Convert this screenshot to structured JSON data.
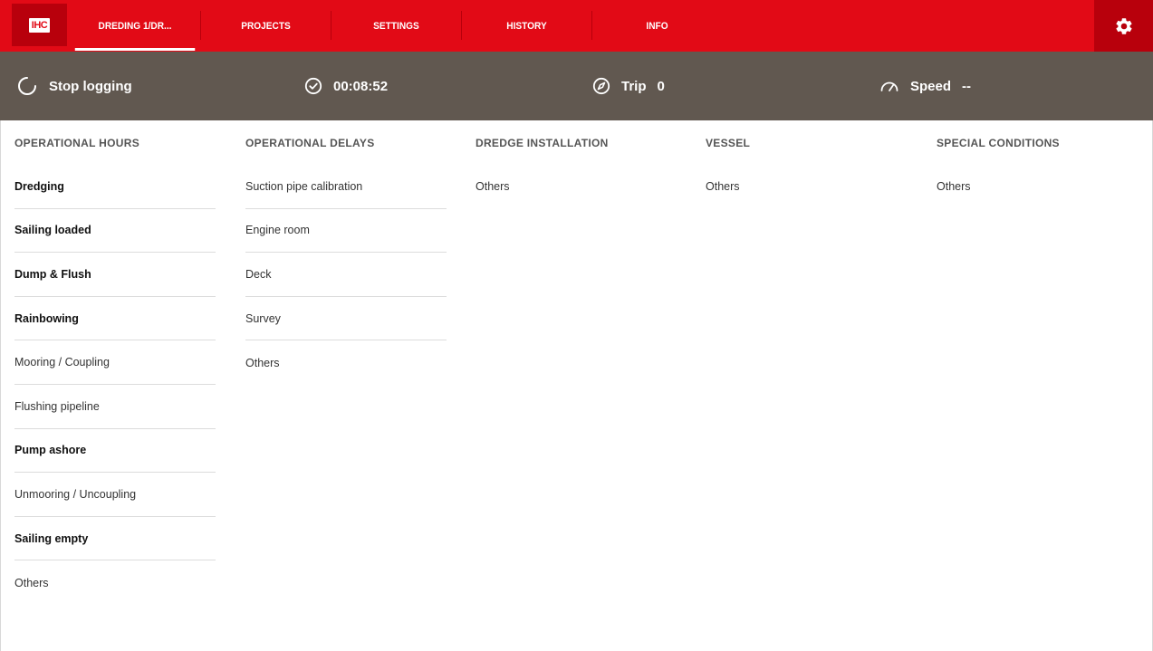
{
  "nav": {
    "logo": "IHC",
    "tabs": [
      {
        "label": "DREDING 1/DR..."
      },
      {
        "label": "PROJECTS"
      },
      {
        "label": "SETTINGS"
      },
      {
        "label": "HISTORY"
      },
      {
        "label": "INFO"
      }
    ],
    "active_tab": "DREDING 1/DR...",
    "settings_icon": "gear-icon"
  },
  "status": {
    "logging_label": "Stop logging",
    "logging_icon": "spinner-icon",
    "timer_value": "00:08:52",
    "timer_icon": "clock-check-icon",
    "trip_label": "Trip",
    "trip_value": "0",
    "trip_icon": "compass-icon",
    "speed_label": "Speed",
    "speed_value": "--",
    "speed_icon": "speedometer-icon"
  },
  "columns": [
    {
      "header": "OPERATIONAL HOURS",
      "items": [
        {
          "label": "Dredging",
          "bold": true
        },
        {
          "label": "Sailing loaded",
          "bold": true
        },
        {
          "label": "Dump & Flush",
          "bold": true
        },
        {
          "label": "Rainbowing",
          "bold": true
        },
        {
          "label": "Mooring / Coupling",
          "bold": false
        },
        {
          "label": "Flushing pipeline",
          "bold": false
        },
        {
          "label": "Pump ashore",
          "bold": true
        },
        {
          "label": "Unmooring / Uncoupling",
          "bold": false
        },
        {
          "label": "Sailing empty",
          "bold": true
        },
        {
          "label": "Others",
          "bold": false
        }
      ]
    },
    {
      "header": "OPERATIONAL DELAYS",
      "items": [
        {
          "label": "Suction pipe calibration",
          "bold": false
        },
        {
          "label": "Engine room",
          "bold": false
        },
        {
          "label": "Deck",
          "bold": false
        },
        {
          "label": "Survey",
          "bold": false
        },
        {
          "label": "Others",
          "bold": false
        }
      ]
    },
    {
      "header": "DREDGE INSTALLATION",
      "items": [
        {
          "label": "Others",
          "bold": false
        }
      ]
    },
    {
      "header": "VESSEL",
      "items": [
        {
          "label": "Others",
          "bold": false
        }
      ]
    },
    {
      "header": "SPECIAL CONDITIONS",
      "items": [
        {
          "label": "Others",
          "bold": false
        }
      ]
    }
  ],
  "colors": {
    "brand_red": "#e20a16",
    "dark_red": "#b8000c",
    "status_bar": "#615850"
  }
}
